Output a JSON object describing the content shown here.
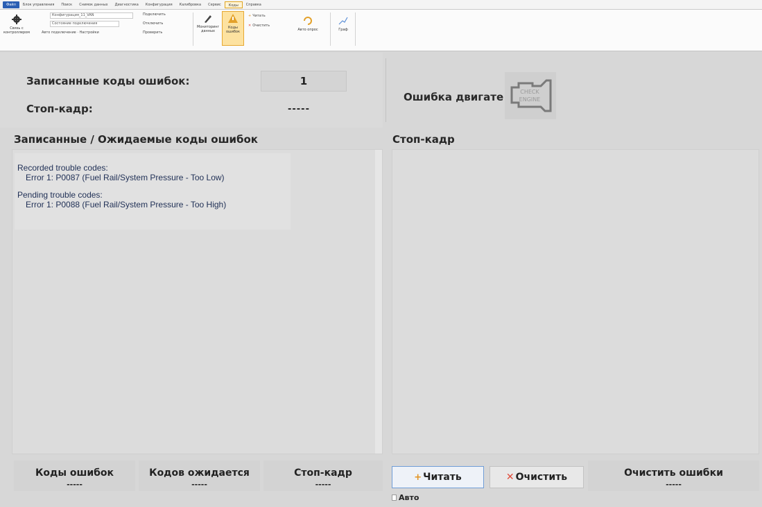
{
  "ribbon_tabs": [
    "Файл",
    "Блок управления",
    "Поиск",
    "Снимок данных",
    "Диагностика",
    "Конфигурация",
    "Калибровка",
    "Сервис",
    "Коды",
    "Справка"
  ],
  "ribbon": {
    "connect_label": "Связь с контроллером",
    "config_value": "Конфигурация_11_VAN",
    "state_value": "Состояние подключения",
    "extra_label": "Авто подключение · Настройки",
    "connect_sub": "Подключить",
    "disconnect_sub": "Отключить",
    "check_sub": "Проверить",
    "monitor_label": "Мониторинг данных",
    "codes_label": "Коды ошибок",
    "read_small": "Читать",
    "clear_small": "Очистить",
    "auto_label": "Авто опрос",
    "graph_label": "Граф",
    "colors": {
      "accent": "#e6a832",
      "file_tab": "#2b5fb3"
    }
  },
  "summary": {
    "recorded_label": "Записанные коды ошибок:",
    "recorded_value": "1",
    "freeze_label": "Стоп-кадр:",
    "freeze_value": "-----",
    "engine_label": "Ошибка двигате",
    "engine_icon": "check-engine-icon",
    "engine_icon_text_1": "CHECK",
    "engine_icon_text_2": "ENGINE"
  },
  "codes_panel": {
    "title": "Записанные / Ожидаемые коды ошибок",
    "recorded_heading": "Recorded trouble codes:",
    "recorded_line": "Error 1: P0087 (Fuel Rail/System Pressure - Too Low)",
    "pending_heading": "Pending trouble codes:",
    "pending_line": "Error 1: P0088 (Fuel Rail/System Pressure - Too High)"
  },
  "freeze_panel": {
    "title": "Стоп-кадр"
  },
  "bottom": {
    "codes_title": "Коды ошибок",
    "codes_value": "-----",
    "pending_title": "Кодов ожидается",
    "pending_value": "-----",
    "freeze_title": "Стоп-кадр",
    "freeze_value": "-----",
    "read_button": "Читать",
    "clear_button": "Очистить",
    "auto_label": "Авто",
    "clear_errors_title": "Очистить ошибки",
    "clear_errors_value": "-----"
  }
}
